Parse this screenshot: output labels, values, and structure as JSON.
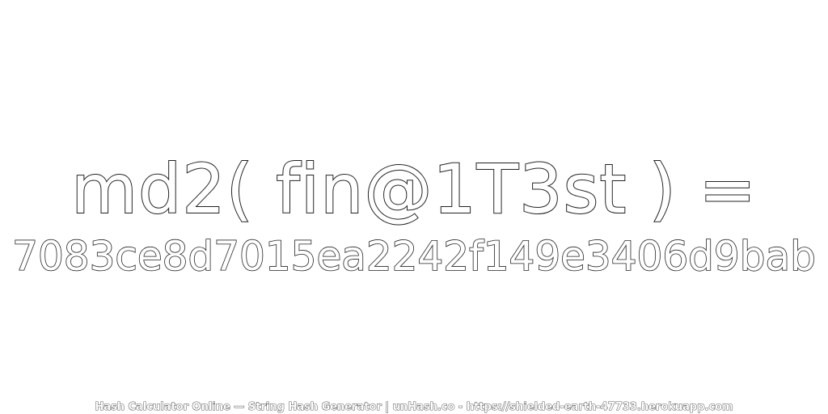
{
  "expression": "md2( fin@1T3st ) =",
  "hash": "7083ce8d7015ea2242f149e3406d9bab",
  "footer": "Hash Calculator Online — String Hash Generator | unHash.co - https://shielded-earth-47733.herokuapp.com",
  "colors": {
    "background": "#ffffff",
    "text_fill": "#ffffff",
    "text_stroke": "#222222"
  }
}
